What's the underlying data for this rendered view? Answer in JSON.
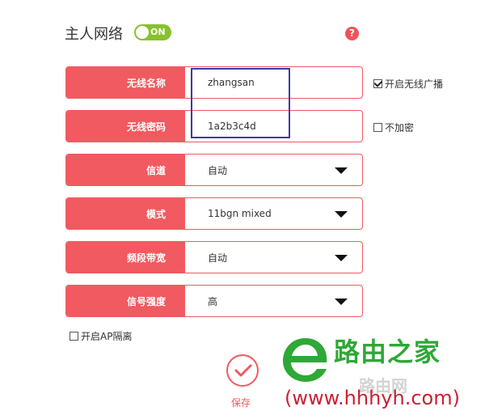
{
  "header": {
    "title": "主人网络",
    "toggle_label": "ON",
    "toggle_state": "on",
    "help_label": "?"
  },
  "fields": {
    "ssid": {
      "label": "无线名称",
      "value": "zhangsan"
    },
    "password": {
      "label": "无线密码",
      "value": "1a2b3c4d"
    },
    "channel": {
      "label": "信道",
      "value": "自动"
    },
    "mode": {
      "label": "模式",
      "value": "11bgn mixed"
    },
    "bandwidth": {
      "label": "频段带宽",
      "value": "自动"
    },
    "signal": {
      "label": "信号强度",
      "value": "高"
    }
  },
  "options": {
    "broadcast": {
      "label": "开启无线广播",
      "checked": true
    },
    "no_encrypt": {
      "label": "不加密",
      "checked": false
    },
    "ap_isolation": {
      "label": "开启AP隔离",
      "checked": false
    }
  },
  "save_label": "保存",
  "watermark": {
    "name": "路由之家",
    "sub": "路由网",
    "url": "(www.hhhyh.com)"
  },
  "colors": {
    "accent": "#f05a60",
    "toggle_on": "#86c22c",
    "highlight": "#3c3c9e",
    "watermark_green": "#2ea836",
    "watermark_red": "#cc1f33"
  },
  "icons": {
    "help": "question-icon",
    "save": "check-icon",
    "dropdown": "caret-down-icon",
    "watermark": "leaf-e-logo-icon"
  }
}
